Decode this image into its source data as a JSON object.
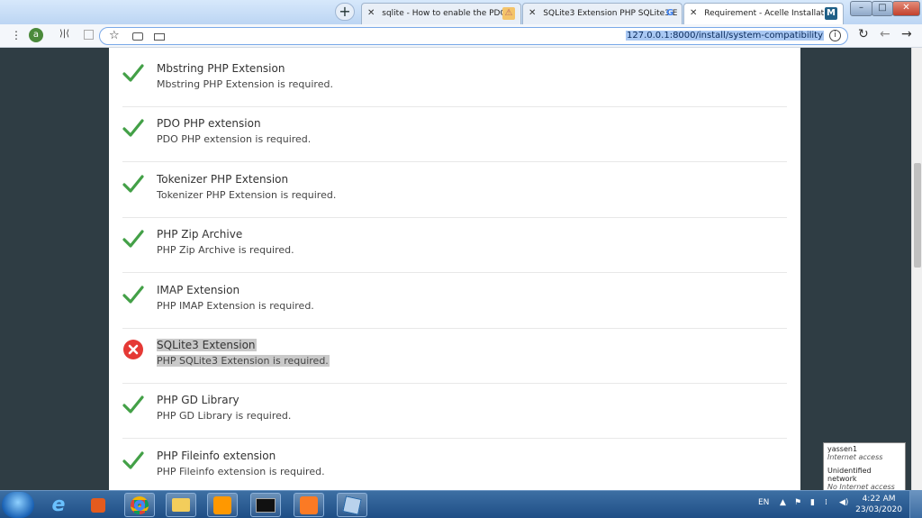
{
  "browser": {
    "new_tab_label": "+",
    "tabs": [
      {
        "label": "sqlite - How to enable the PDO d",
        "close": "✕",
        "icon": "pdo-favicon",
        "active": false
      },
      {
        "label": "SQLite3 Extension PHP SQLite3 E",
        "close": "✕",
        "icon": "google-favicon",
        "active": false
      },
      {
        "label": "Requirement - Acelle Installation",
        "close": "✕",
        "icon": "acelle-favicon",
        "active": true
      }
    ],
    "favicon_glyphs": {
      "pdo": "⚠",
      "google": "G",
      "acelle": "M"
    },
    "window_controls": {
      "min": "–",
      "max": "□",
      "close": "✕"
    },
    "address": {
      "menu_icon": "⋮",
      "profile_letter": "a",
      "url": "127.0.0.1:8000/install/system-compatibility",
      "info_icon": "i",
      "reload_icon": "↻",
      "back_icon": "←",
      "forward_icon": "→",
      "ext_icon": "⟩|⟨",
      "star_icon": "☆"
    }
  },
  "requirements": [
    {
      "title": "Mbstring PHP Extension",
      "desc": "Mbstring PHP Extension is required.",
      "ok": true
    },
    {
      "title": "PDO PHP extension",
      "desc": "PDO PHP extension is required.",
      "ok": true
    },
    {
      "title": "Tokenizer PHP Extension",
      "desc": "Tokenizer PHP Extension is required.",
      "ok": true
    },
    {
      "title": "PHP Zip Archive",
      "desc": "PHP Zip Archive is required.",
      "ok": true
    },
    {
      "title": "IMAP Extension",
      "desc": "PHP IMAP Extension is required.",
      "ok": true
    },
    {
      "title": "SQLite3 Extension",
      "desc": "PHP SQLite3 Extension is required.",
      "ok": false,
      "selected": true
    },
    {
      "title": "PHP GD Library",
      "desc": "PHP GD Library is required.",
      "ok": true
    },
    {
      "title": "PHP Fileinfo extension",
      "desc": "PHP Fileinfo extension is required.",
      "ok": true
    }
  ],
  "colors": {
    "ok": "#43a047",
    "fail": "#e53935"
  },
  "network_popup": {
    "line1": "yassen1",
    "line2": "Internet access",
    "line3": "Unidentified network",
    "line4": "No Internet access"
  },
  "taskbar": {
    "apps": [
      "ie-icon",
      "media-player-icon",
      "chrome-icon",
      "file-explorer-icon",
      "sublime-text-icon",
      "cmd-icon",
      "xampp-icon",
      "virtualbox-icon"
    ],
    "lang": "EN",
    "time": "4:22 AM",
    "date": "23/03/2020"
  }
}
